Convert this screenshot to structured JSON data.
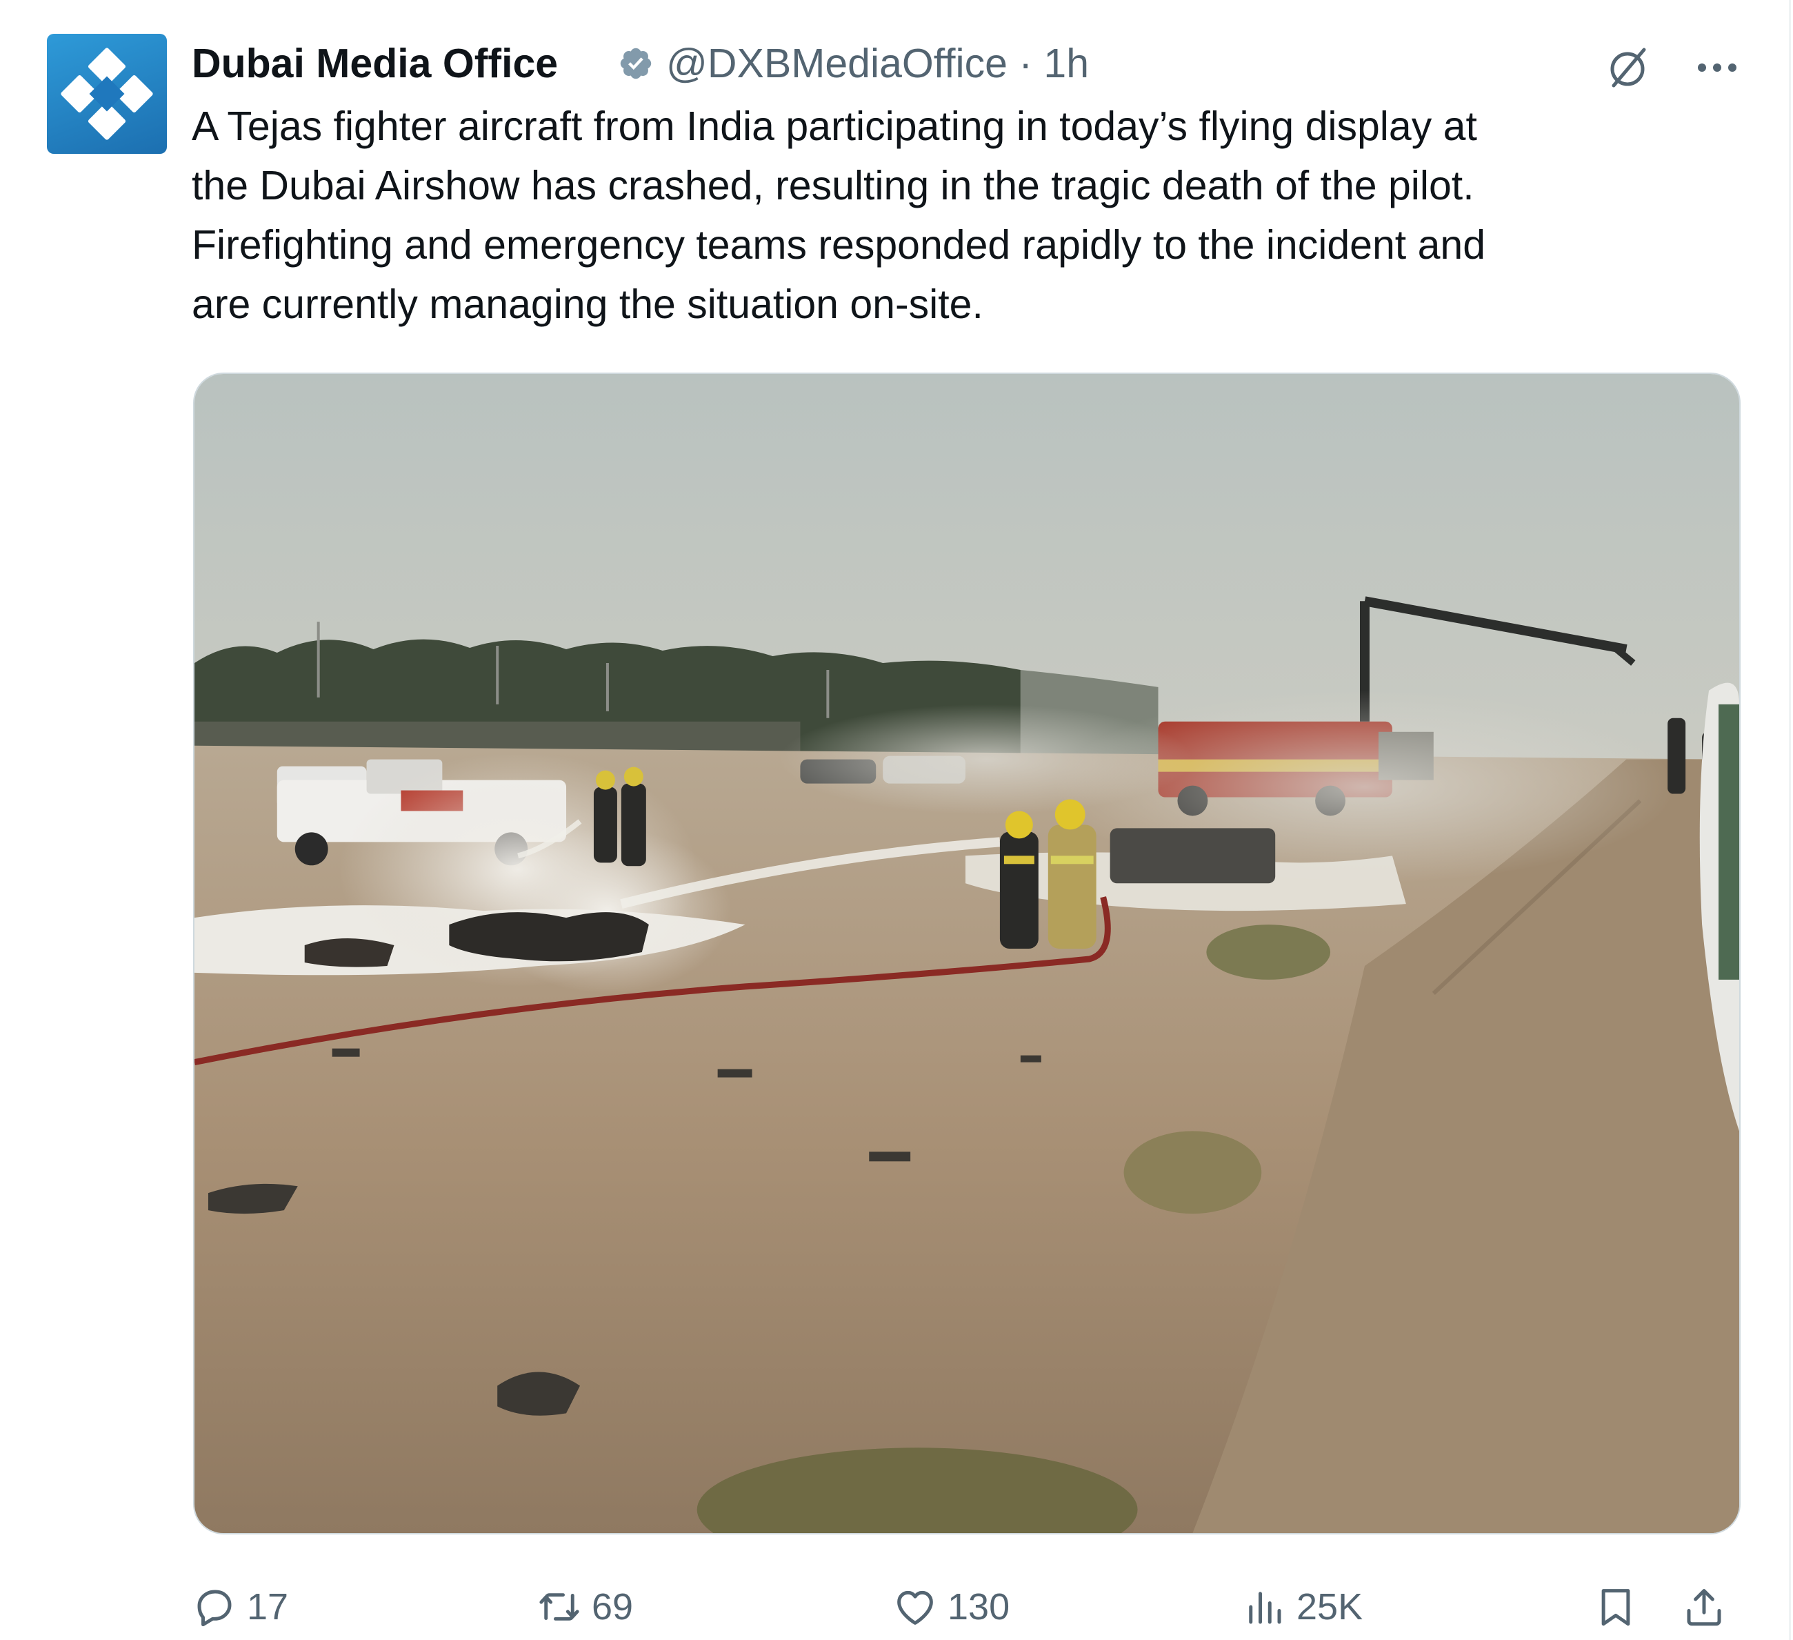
{
  "tweet": {
    "author": {
      "display_name": "Dubai Media Office",
      "handle": "@DXBMediaOffice",
      "time_sep": " · ",
      "time": "1h",
      "verified_icon": "verified-badge-icon",
      "avatar_icon": "dubai-media-office-logo"
    },
    "text": "A Tejas fighter aircraft from India participating in today’s flying display at\nthe Dubai Airshow has crashed, resulting in the tragic death of the pilot.\nFirefighting and emergency teams responded rapidly to the incident and\nare currently managing the situation on-site.",
    "media": {
      "type": "photo",
      "subject": "firefighters spraying foam on burning wreckage at a desert crash site, fire truck with boom in background"
    },
    "actions": {
      "reply_count": "17",
      "retweet_count": "69",
      "like_count": "130",
      "view_count": "25K"
    }
  },
  "colors": {
    "text": "#0f1419",
    "secondary": "#536471",
    "verified": "#829aab",
    "avatar_blue": "#1f78bd"
  }
}
